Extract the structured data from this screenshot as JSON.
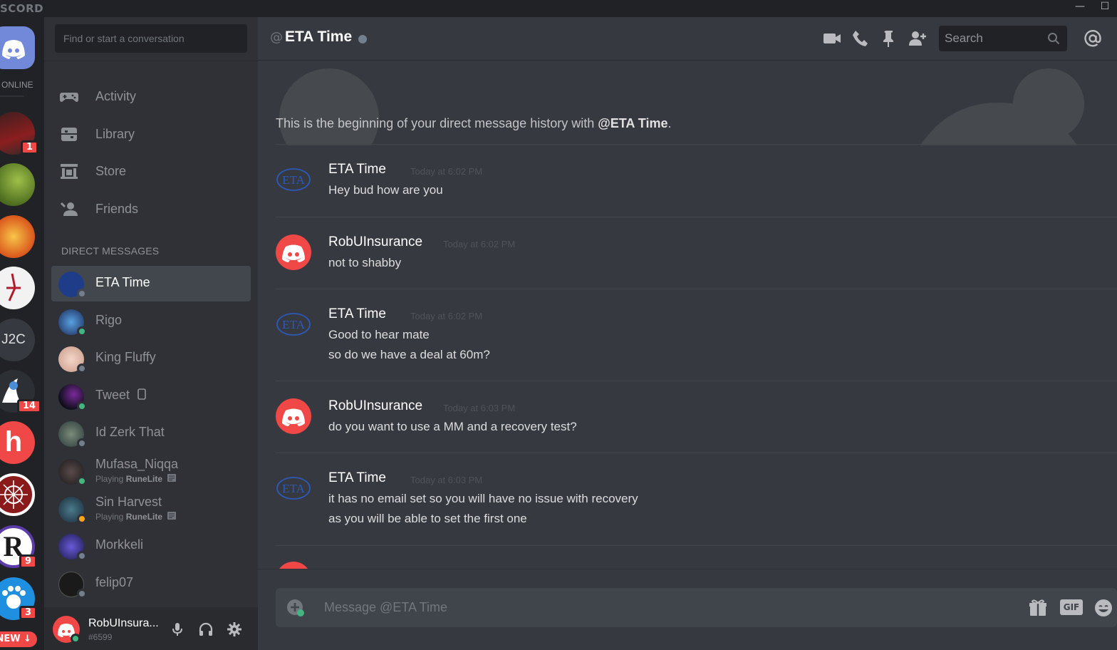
{
  "app": {
    "brand": "SCORD",
    "minimize": "—",
    "maximize": "☐"
  },
  "servers": {
    "online_label": "ONLINE",
    "j2c_label": "J2C",
    "badges": [
      "1",
      "14",
      "9",
      "3"
    ],
    "new_label": "NEW ↓"
  },
  "sidebar": {
    "search_placeholder": "Find or start a conversation",
    "nav": [
      {
        "label": "Activity",
        "icon": "gamepad-icon"
      },
      {
        "label": "Library",
        "icon": "library-icon"
      },
      {
        "label": "Store",
        "icon": "store-icon"
      },
      {
        "label": "Friends",
        "icon": "friends-icon"
      }
    ],
    "dm_header": "DIRECT MESSAGES",
    "dms": [
      {
        "name": "ETA Time",
        "status": "offline",
        "active": true
      },
      {
        "name": "Rigo",
        "status": "online"
      },
      {
        "name": "King Fluffy",
        "status": "offline"
      },
      {
        "name": "Tweet",
        "status": "online",
        "mobile": true
      },
      {
        "name": "Id Zerk That",
        "status": "offline"
      },
      {
        "name": "Mufasa_Niqqa",
        "status": "online",
        "activity_prefix": "Playing ",
        "activity": "RuneLite"
      },
      {
        "name": "Sin Harvest",
        "status": "idle",
        "activity_prefix": "Playing ",
        "activity": "RuneLite"
      },
      {
        "name": "Morkkeli",
        "status": "offline"
      },
      {
        "name": "felip07",
        "status": "offline"
      }
    ],
    "user": {
      "name": "RobUInsura...",
      "tag": "#6599"
    }
  },
  "chat": {
    "at": "@",
    "title": "ETA Time",
    "search_placeholder": "Search",
    "beginning_prefix": "This is the beginning of your direct message history with ",
    "beginning_name": "@ETA Time",
    "beginning_suffix": ".",
    "messages": [
      {
        "author": "ETA Time",
        "time": "Today at 6:02 PM",
        "lines": [
          "Hey bud how are you"
        ],
        "avatar": "eta"
      },
      {
        "author": "RobUInsurance",
        "time": "Today at 6:02 PM",
        "lines": [
          "not to shabby"
        ],
        "avatar": "discord"
      },
      {
        "author": "ETA Time",
        "time": "Today at 6:02 PM",
        "lines": [
          "Good to hear mate",
          "so do we have a deal at 60m?"
        ],
        "avatar": "eta"
      },
      {
        "author": "RobUInsurance",
        "time": "Today at 6:03 PM",
        "lines": [
          "do you want to use a MM and a recovery test?"
        ],
        "avatar": "discord"
      },
      {
        "author": "ETA Time",
        "time": "Today at 6:03 PM",
        "lines": [
          "it has no email set so you will have no issue with recovery",
          "as you will be able to set the first one"
        ],
        "avatar": "eta"
      }
    ],
    "composer_placeholder": "Message @ETA Time",
    "eta_logo": "ETA",
    "gif_label": "GIF"
  },
  "colors": {
    "accent": "#7289da",
    "online": "#43b581",
    "idle": "#faa61a",
    "offline": "#747f8d",
    "danger": "#f04747"
  }
}
